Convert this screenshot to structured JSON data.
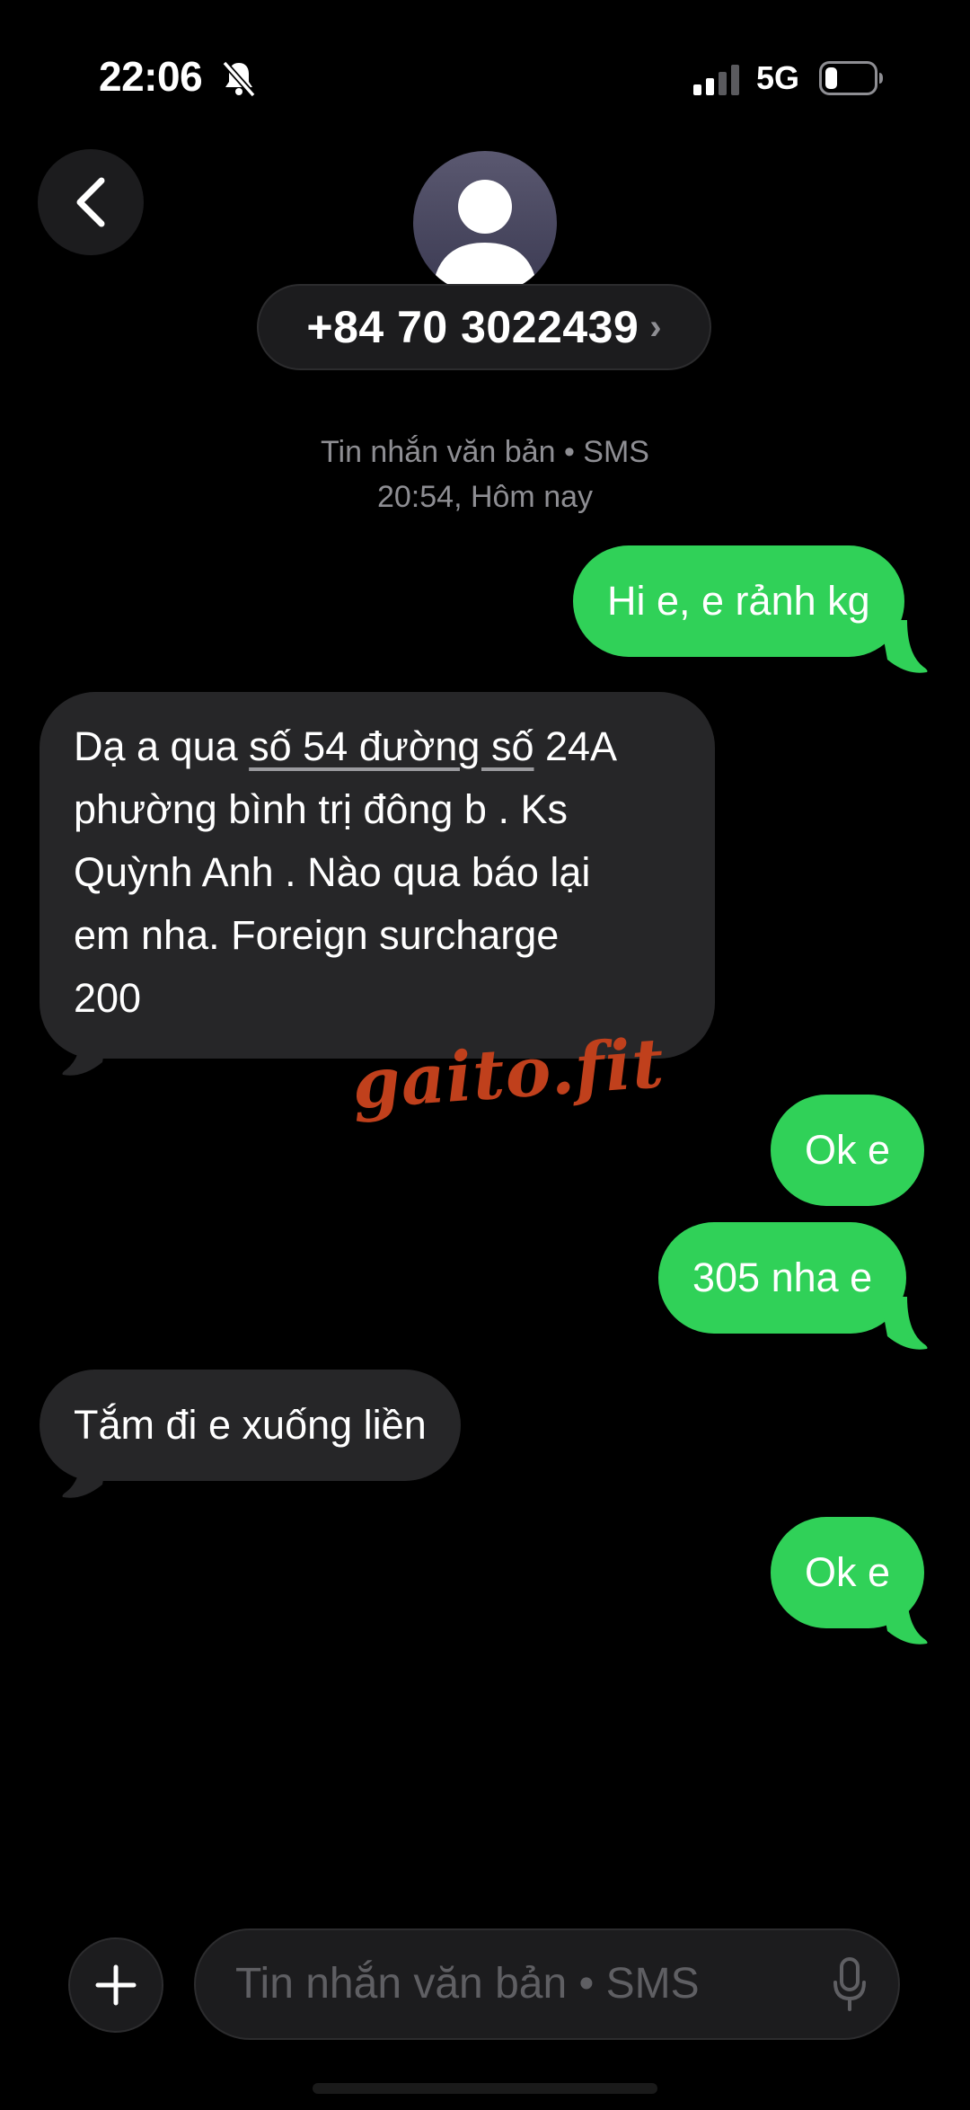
{
  "status_bar": {
    "time": "22:06",
    "network": "5G",
    "icons": [
      "bell-slash-icon",
      "cellular-signal-icon",
      "battery-icon"
    ]
  },
  "header": {
    "contact": "+84 70 3022439",
    "chevron": "›"
  },
  "thread": {
    "meta_line1": "Tin nhắn văn bản • SMS",
    "meta_line2": "20:54, Hôm nay"
  },
  "messages": [
    {
      "direction": "outgoing",
      "text": "Hi e, e rảnh kg"
    },
    {
      "direction": "incoming",
      "lines": [
        {
          "pre": "Dạ a qua ",
          "link": "số 54 đường số",
          "post": " 24A"
        },
        {
          "text": "phường bình trị đông b . Ks"
        },
        {
          "text": "Quỳnh Anh . Nào qua báo lại"
        },
        {
          "text": "em nha. Foreign surcharge"
        },
        {
          "text": "200"
        }
      ]
    },
    {
      "direction": "outgoing",
      "text": "Ok e"
    },
    {
      "direction": "outgoing",
      "text": "305 nha e"
    },
    {
      "direction": "incoming",
      "text": "Tắm đi e xuống liền"
    },
    {
      "direction": "outgoing",
      "text": "Ok e"
    }
  ],
  "watermark": "gaito.fit",
  "compose": {
    "placeholder": "Tin nhắn văn bản • SMS"
  },
  "colors": {
    "outgoing_bubble": "#30d158",
    "incoming_bubble": "#262628",
    "watermark": "#c0401c"
  }
}
